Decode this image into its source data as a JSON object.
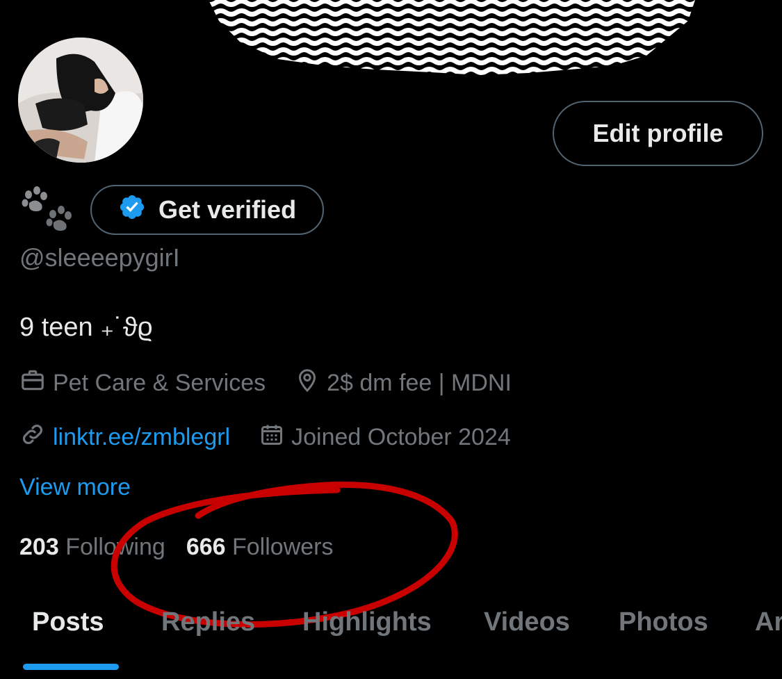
{
  "profile": {
    "edit_profile_label": "Edit profile",
    "get_verified_label": "Get verified",
    "handle": "@sleeeepygirI",
    "bio": "9 teen ₊˙ϑϱ",
    "category": "Pet Care & Services",
    "location": "2$ dm fee | MDNI",
    "website": "linktr.ee/zmblegrl",
    "joined": "Joined October 2024",
    "view_more_label": "View more"
  },
  "stats": {
    "following_count": "203",
    "following_label": "Following",
    "followers_count": "666",
    "followers_label": "Followers"
  },
  "tabs": [
    "Posts",
    "Replies",
    "Highlights",
    "Videos",
    "Photos",
    "Ar"
  ],
  "active_tab": "Posts",
  "icons": {
    "verified": "verified-badge-icon",
    "category": "briefcase-icon",
    "location": "location-pin-icon",
    "website": "link-icon",
    "joined": "calendar-icon",
    "name": "paw-prints-icon"
  },
  "colors": {
    "background": "#000000",
    "text_primary": "#e7e9ea",
    "text_secondary": "#71767b",
    "accent": "#1d9bf0",
    "annotation": "#c90000"
  }
}
